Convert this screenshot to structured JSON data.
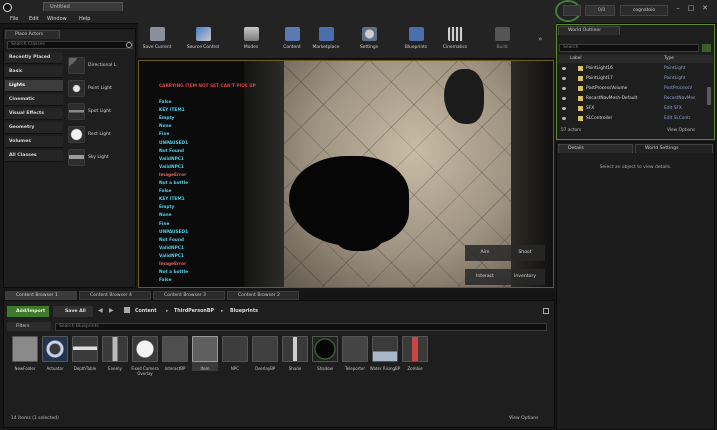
{
  "menu": [
    "File",
    "Edit",
    "Window",
    "Help"
  ],
  "doc_tab": "Untitled",
  "window": {
    "right_label": "cognatoio",
    "pill_1": "",
    "pill_2": "0/0"
  },
  "place_actors": {
    "tab": "Place Actors",
    "search_placeholder": "Search Classes",
    "categories": [
      "Recently Placed",
      "Basic",
      "Lights",
      "Cinematic",
      "Visual Effects",
      "Geometry",
      "Volumes",
      "All Classes"
    ],
    "active_category": "Lights",
    "actors": [
      "Directional L",
      "Point Light",
      "Spot Light",
      "Rect Light",
      "Sky Light"
    ]
  },
  "toolbar": {
    "buttons": [
      "Save Current",
      "Source Control",
      "Modes",
      "Content",
      "Marketplace",
      "Settings",
      "Blueprints",
      "Cinematics",
      "Build"
    ]
  },
  "viewport": {
    "header_error": "CARRYING ITEM NOT SET CAN'T PICK UP",
    "log_lines": [
      {
        "text": "False",
        "color": "#4fd0e8"
      },
      {
        "text": "KEY ITEM1",
        "color": "#4fd0e8"
      },
      {
        "text": "Empty",
        "color": "#4fd0e8"
      },
      {
        "text": "None",
        "color": "#4fd0e8"
      },
      {
        "text": "Fine",
        "color": "#4fd0e8"
      },
      {
        "text": "UNPAUSED1",
        "color": "#4fd0e8"
      },
      {
        "text": "Not Found",
        "color": "#4fd0e8"
      },
      {
        "text": "ValidNPC1",
        "color": "#4fd0e8"
      },
      {
        "text": "ValidNPC1",
        "color": "#4fd0e8"
      },
      {
        "text": "ImageError",
        "color": "#e06060"
      },
      {
        "text": "Not a bottle",
        "color": "#4fd0e8"
      },
      {
        "text": "False",
        "color": "#4fd0e8"
      },
      {
        "text": "KEY ITEM1",
        "color": "#4fd0e8"
      },
      {
        "text": "Empty",
        "color": "#4fd0e8"
      },
      {
        "text": "None",
        "color": "#4fd0e8"
      },
      {
        "text": "Fine",
        "color": "#4fd0e8"
      },
      {
        "text": "UNPAUSED1",
        "color": "#4fd0e8"
      },
      {
        "text": "Not Found",
        "color": "#4fd0e8"
      },
      {
        "text": "ValidNPC1",
        "color": "#4fd0e8"
      },
      {
        "text": "ValidNPC1",
        "color": "#4fd0e8"
      },
      {
        "text": "ImageError",
        "color": "#e06060"
      },
      {
        "text": "Not a bottle",
        "color": "#4fd0e8"
      },
      {
        "text": "False",
        "color": "#4fd0e8"
      }
    ],
    "hud_buttons": [
      "Aim",
      "Shoot",
      "Interact",
      "Inventory"
    ]
  },
  "outliner": {
    "tab": "World Outliner",
    "search_placeholder": "Search",
    "col_label": "Label",
    "col_type": "Type",
    "rows": [
      {
        "label": "PointLight16",
        "type": "PointLight"
      },
      {
        "label": "PointLight17",
        "type": "PointLight"
      },
      {
        "label": "PostProcessVolume",
        "type": "PostProcessV"
      },
      {
        "label": "RecastNavMesh-Default",
        "type": "RecastNavMes"
      },
      {
        "label": "SFX",
        "type": "Edit SFX"
      },
      {
        "label": "SLController",
        "type": "Edit SLContr"
      }
    ],
    "count": "57 actors",
    "view_options": "View Options"
  },
  "details": {
    "tab_details": "Details",
    "tab_world": "World Settings",
    "empty_message": "Select an object to view details."
  },
  "content_browser": {
    "tabs": [
      "Content Browser 1",
      "Content Browser 4",
      "Content Browser 3",
      "Content Browser 2"
    ],
    "add_import": "Add/Import",
    "save_all": "Save All",
    "breadcrumb": [
      "Content",
      "ThirdPersonBP",
      "Blueprints"
    ],
    "filters": "Filters",
    "search_placeholder": "Search Blueprints",
    "assets": [
      "NewFolder",
      "Actuator",
      "DepthTable",
      "Enemy",
      "Fixed Camera Overlay",
      "InteractBP",
      "Item",
      "NPC",
      "OverlayBP",
      "Shade",
      "Shadow",
      "Teleporter",
      "Water RisingBP",
      "Zombie"
    ],
    "status": "14 items (1 selected)",
    "view_options": "View Options"
  }
}
